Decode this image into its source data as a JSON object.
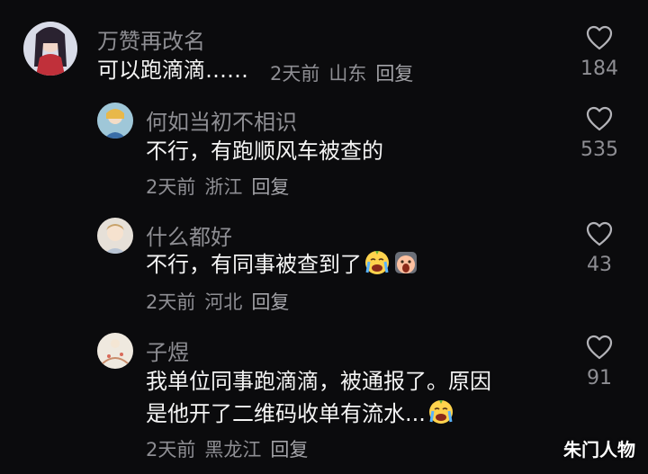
{
  "comments": [
    {
      "username": "万赞再改名",
      "text": "可以跑滴滴……",
      "time": "2天前",
      "location": "山东",
      "reply_label": "回复",
      "likes": "184"
    },
    {
      "username": "何如当初不相识",
      "text": "不行，有跑顺风车被查的",
      "time": "2天前",
      "location": "浙江",
      "reply_label": "回复",
      "likes": "535"
    },
    {
      "username": "什么都好",
      "text": "不行，有同事被查到了",
      "time": "2天前",
      "location": "河北",
      "reply_label": "回复",
      "likes": "43"
    },
    {
      "username": "子煜",
      "text_line1": "我单位同事跑滴滴，被通报了。原因",
      "text_line2": "是他开了二维码收单有流水...",
      "time": "2天前",
      "location": "黑龙江",
      "reply_label": "回复",
      "likes": "91"
    }
  ],
  "watermark": "朱门人物",
  "icons": {
    "like": "heart-outline-icon",
    "emoji_cry": "crying-emoji-icon",
    "emoji_scream": "screaming-emoji-icon"
  },
  "colors": {
    "background": "#0b0b0d",
    "username": "#8e8e93",
    "text": "#f4f4f4",
    "meta": "#8e8e93"
  }
}
